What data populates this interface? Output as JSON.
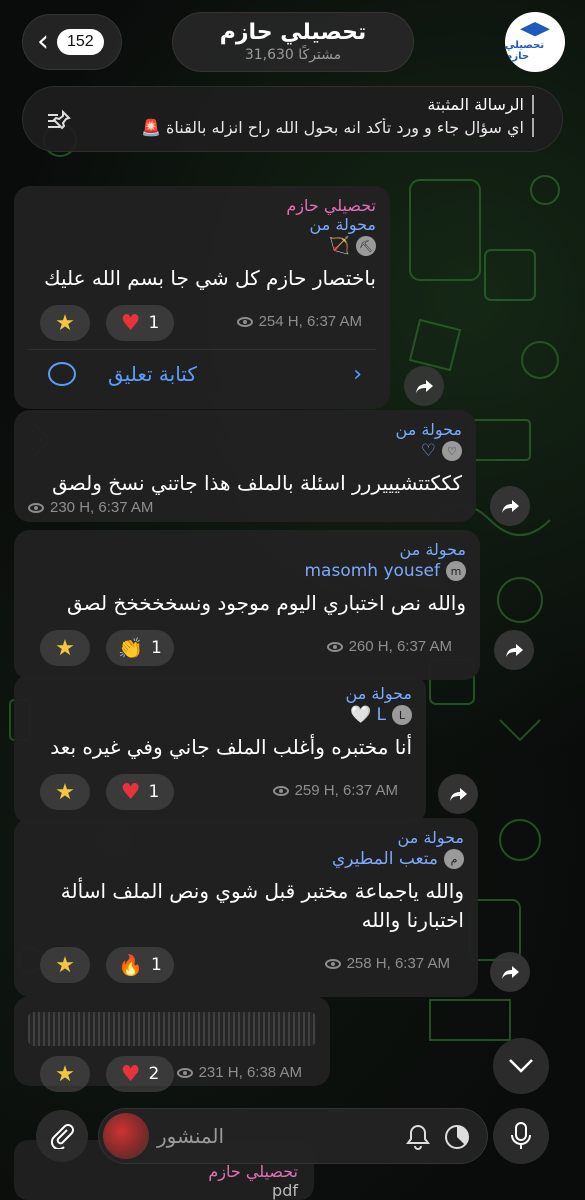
{
  "header": {
    "back_count": "152",
    "title": "تحصيلي حازم",
    "subtitle": "31,630 مشتركًا",
    "logo_text": "تحصيلي حازم"
  },
  "pinned": {
    "label": "الرسالة المثبتة",
    "text": "اي سؤال جاء و ورد تأكد انه بحول الله راح انزله بالقناة 🚨"
  },
  "messages": [
    {
      "channel": "تحصيلي حازم",
      "forwarded_label": "محولة من",
      "sender": "",
      "sender_emoji": "🏹",
      "sender_initial": "",
      "text": "باختصار حازم كل شي جا بسم الله عليك",
      "reaction_count": "1",
      "views": "254 H, 6:37 AM",
      "comment_label": "كتابة تعليق"
    },
    {
      "forwarded_label": "محولة من",
      "sender": "",
      "sender_emoji": "♡",
      "sender_initial": "",
      "text": "كككتتشيييررر اسئلة بالملف هذا جاتني نسخ ولصق",
      "views": "230 H, 6:37 AM"
    },
    {
      "forwarded_label": "محولة من",
      "sender": "masomh yousef",
      "sender_initial": "m",
      "text": "والله نص اختباري اليوم موجود ونسخخخخخ لصق",
      "reaction_count": "1",
      "views": "260 H, 6:37 AM"
    },
    {
      "forwarded_label": "محولة من",
      "sender": "L 🤍",
      "sender_initial": "L",
      "text": "أنا مختبره وأغلب الملف جاني وفي غيره بعد",
      "reaction_count": "1",
      "views": "259 H, 6:37 AM"
    },
    {
      "forwarded_label": "محولة من",
      "sender": "متعب المطيري",
      "sender_initial": "م",
      "text": "والله ياجماعة مختبر قبل شوي ونص الملف اسألة اختبارنا والله",
      "reaction_count": "1",
      "views": "258 H, 6:37 AM"
    },
    {
      "reaction_count": "2",
      "views": "231 H, 6:38 AM"
    }
  ],
  "input": {
    "placeholder": "المنشور"
  },
  "peek": {
    "channel": "تحصيلي حازم",
    "text": "pdf"
  },
  "colors": {
    "accent": "#5b9cff",
    "forward": "#7aa9ff",
    "channel": "#e26fb7",
    "bubble": "#212121"
  }
}
